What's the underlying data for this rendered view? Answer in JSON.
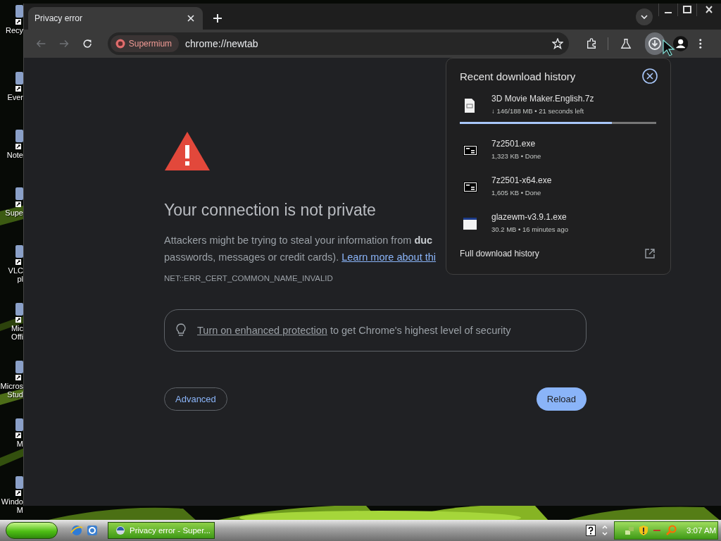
{
  "desktop": {
    "icons": [
      {
        "lines": [
          "Recy"
        ]
      },
      {
        "lines": [
          "Ever"
        ]
      },
      {
        "lines": [
          "Note"
        ]
      },
      {
        "lines": [
          "Supe"
        ]
      },
      {
        "lines": [
          "VLC",
          "pl"
        ]
      },
      {
        "lines": [
          "Mic",
          "Offi"
        ]
      },
      {
        "lines": [
          "Micros",
          "Stud"
        ]
      },
      {
        "lines": [
          "M"
        ]
      },
      {
        "lines": [
          "Windo",
          "M"
        ]
      }
    ]
  },
  "browser": {
    "tabs": [
      {
        "title": "Privacy error",
        "selected": true
      }
    ],
    "toolbar": {
      "site_chip": "Supermium",
      "address": "chrome://newtab",
      "bookmarked": false,
      "downloads_open": true
    },
    "page": {
      "heading": "Your connection is not private",
      "line_1": "Attackers might be trying to steal your information from **duc**",
      "line_2": "passwords, messages or credit cards). ",
      "learn_more": "Learn more about thi",
      "error_code": "NET::ERR_CERT_COMMON_NAME_INVALID",
      "protection": {
        "link": "Turn on enhanced protection",
        "text": " to get Chrome's highest level of security"
      },
      "buttons": [
        {
          "label": "Advanced",
          "kind": "secondary"
        },
        {
          "label": "Reload",
          "kind": "primary"
        }
      ]
    },
    "downloads_popup": {
      "title": "Recent download history",
      "items": [
        {
          "name": "3D Movie Maker.English.7z",
          "status": "↓ 146/188 MB • 21 seconds left",
          "kind": "document",
          "level": 0.775
        },
        {
          "name": "7z2501.exe",
          "status": "1,323 KB • Done",
          "kind": "sevenzip"
        },
        {
          "name": "7z2501-x64.exe",
          "status": "1,605 KB • Done",
          "kind": "sevenzip"
        },
        {
          "name": "glazewm-v3.9.1.exe",
          "status": "30.2 MB • 16 minutes ago",
          "kind": "window"
        }
      ],
      "footer": "Full download history"
    }
  },
  "taskbar": {
    "tasks": [
      {
        "label": "Privacy error - Super...",
        "selected": true
      }
    ],
    "clock": "3:07 AM"
  }
}
